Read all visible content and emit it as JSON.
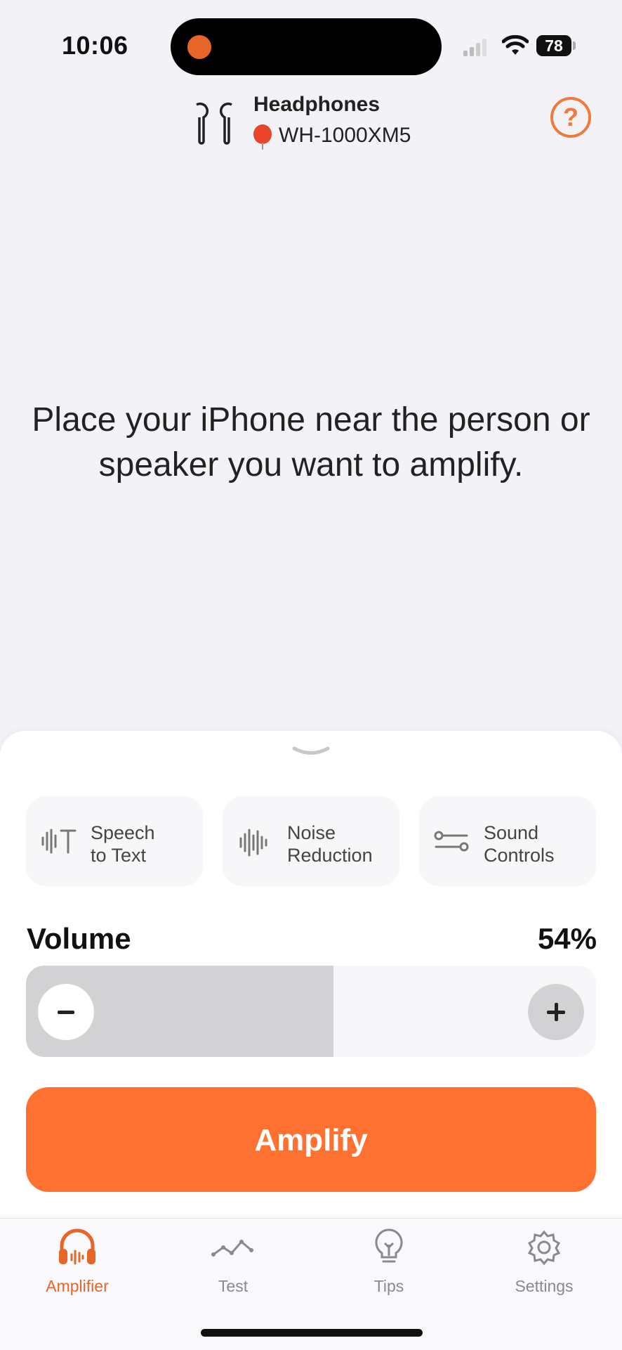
{
  "status_bar": {
    "time": "10:06",
    "battery": "78"
  },
  "header": {
    "device_type": "Headphones",
    "device_name": "WH-1000XM5",
    "help_icon": "?"
  },
  "instruction": "Place your iPhone near the person or speaker you want to amplify.",
  "features": [
    {
      "line1": "Speech",
      "line2": "to Text",
      "icon": "speech-to-text-icon"
    },
    {
      "line1": "Noise",
      "line2": "Reduction",
      "icon": "waveform-icon"
    },
    {
      "line1": "Sound",
      "line2": "Controls",
      "icon": "sliders-icon"
    }
  ],
  "volume": {
    "label": "Volume",
    "value_text": "54%",
    "level": 0.54
  },
  "amplify_label": "Amplify",
  "tabs": [
    {
      "label": "Amplifier",
      "icon": "headphones-icon",
      "active": true
    },
    {
      "label": "Test",
      "icon": "graph-icon",
      "active": false
    },
    {
      "label": "Tips",
      "icon": "lightbulb-icon",
      "active": false
    },
    {
      "label": "Settings",
      "icon": "gear-icon",
      "active": false
    }
  ],
  "colors": {
    "accent": "#ff7130",
    "background": "#f3f2f7"
  }
}
